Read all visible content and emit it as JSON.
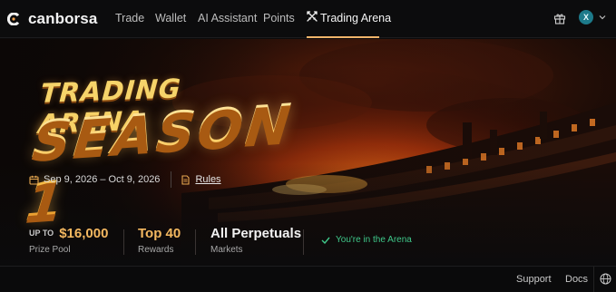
{
  "brand": {
    "name": "canborsa"
  },
  "nav": {
    "items": [
      {
        "label": "Trade"
      },
      {
        "label": "Wallet"
      },
      {
        "label": "AI Assistant"
      },
      {
        "label": "Points"
      },
      {
        "label": "Trading Arena",
        "active": true
      }
    ],
    "avatar_initial": "X"
  },
  "hero": {
    "title_line1": "TRADING ARENA",
    "title_line2": "SEASON 1",
    "dates": "Sep 9, 2026 – Oct 9, 2026",
    "rules_label": "Rules"
  },
  "stats": {
    "prize": {
      "prefix": "UP TO",
      "value": "$16,000",
      "label": "Prize Pool"
    },
    "rewards": {
      "value": "Top 40",
      "label": "Rewards"
    },
    "markets": {
      "value": "All Perpetuals",
      "label": "Markets"
    },
    "status": "You're in the Arena"
  },
  "footer": {
    "support": "Support",
    "docs": "Docs"
  },
  "colors": {
    "accent": "#f4b860",
    "success": "#3fc88a",
    "background": "#0b0b0c"
  },
  "icons": [
    "logo-icon",
    "swords-icon",
    "gift-icon",
    "chevron-down-icon",
    "calendar-icon",
    "document-icon",
    "check-icon",
    "globe-icon"
  ]
}
